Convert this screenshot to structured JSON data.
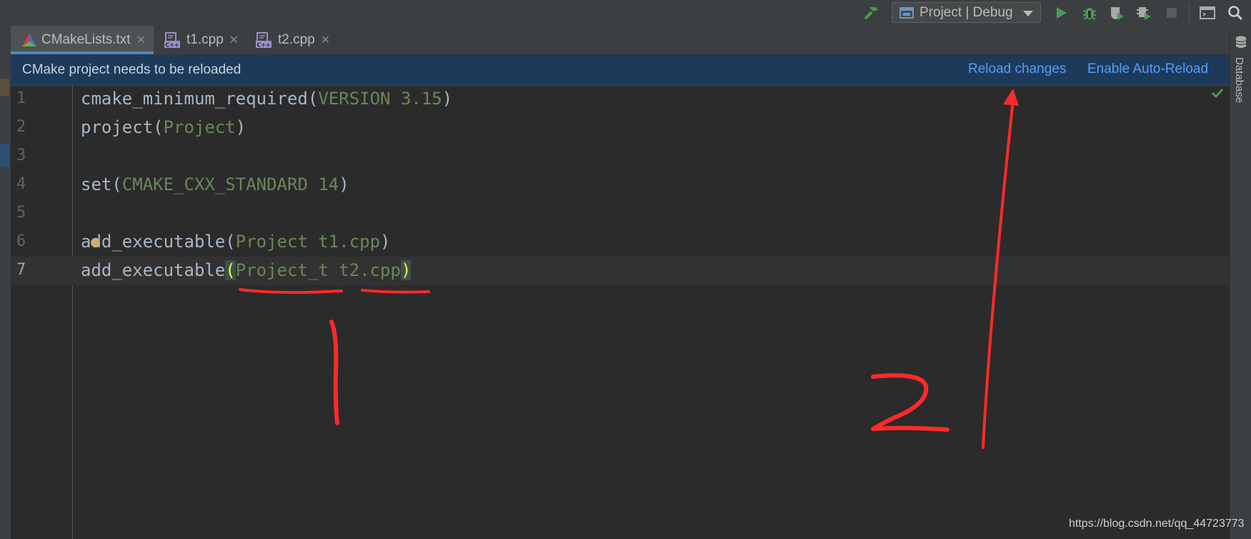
{
  "toolbar": {
    "run_config": "Project | Debug",
    "icons": [
      "build-hammer-icon",
      "run-config-icon",
      "run-icon",
      "debug-icon",
      "coverage-icon",
      "profile-icon",
      "stop-icon",
      "terminal-layout-icon",
      "search-icon"
    ]
  },
  "tabs": [
    {
      "label": "CMakeLists.txt",
      "icon": "cmake-icon",
      "active": true
    },
    {
      "label": "t1.cpp",
      "icon": "cpp-file-icon",
      "active": false
    },
    {
      "label": "t2.cpp",
      "icon": "cpp-file-icon",
      "active": false
    }
  ],
  "banner": {
    "message": "CMake project needs to be reloaded",
    "reload_label": "Reload changes",
    "auto_reload_label": "Enable Auto-Reload"
  },
  "right_panel": {
    "database_label": "Database"
  },
  "editor": {
    "lines": [
      {
        "num": "1",
        "fn": "cmake_minimum_required",
        "open": "(",
        "arg": "VERSION 3.15",
        "close": ")"
      },
      {
        "num": "2",
        "fn": "project",
        "open": "(",
        "arg": "Project",
        "close": ")"
      },
      {
        "num": "3",
        "fn": "",
        "open": "",
        "arg": "",
        "close": ""
      },
      {
        "num": "4",
        "fn": "set",
        "open": "(",
        "arg": "CMAKE_CXX_STANDARD 14",
        "close": ")"
      },
      {
        "num": "5",
        "fn": "",
        "open": "",
        "arg": "",
        "close": ""
      },
      {
        "num": "6",
        "fn": "add_executable",
        "open": "(",
        "arg": "Project t1.cpp",
        "close": ")"
      },
      {
        "num": "7",
        "fn": "add_executable",
        "open": "(",
        "arg": "Project_t t2.cpp",
        "close": ")"
      }
    ],
    "current_line": "7"
  },
  "annotations": {
    "label_1": "1",
    "label_2": "2",
    "color": "#ff2a2a"
  },
  "watermark": "https://blog.csdn.net/qq_44723773",
  "colors": {
    "accent": "#4a88c7",
    "link": "#589df6",
    "string_arg": "#6a8759",
    "run_green": "#499c54"
  }
}
